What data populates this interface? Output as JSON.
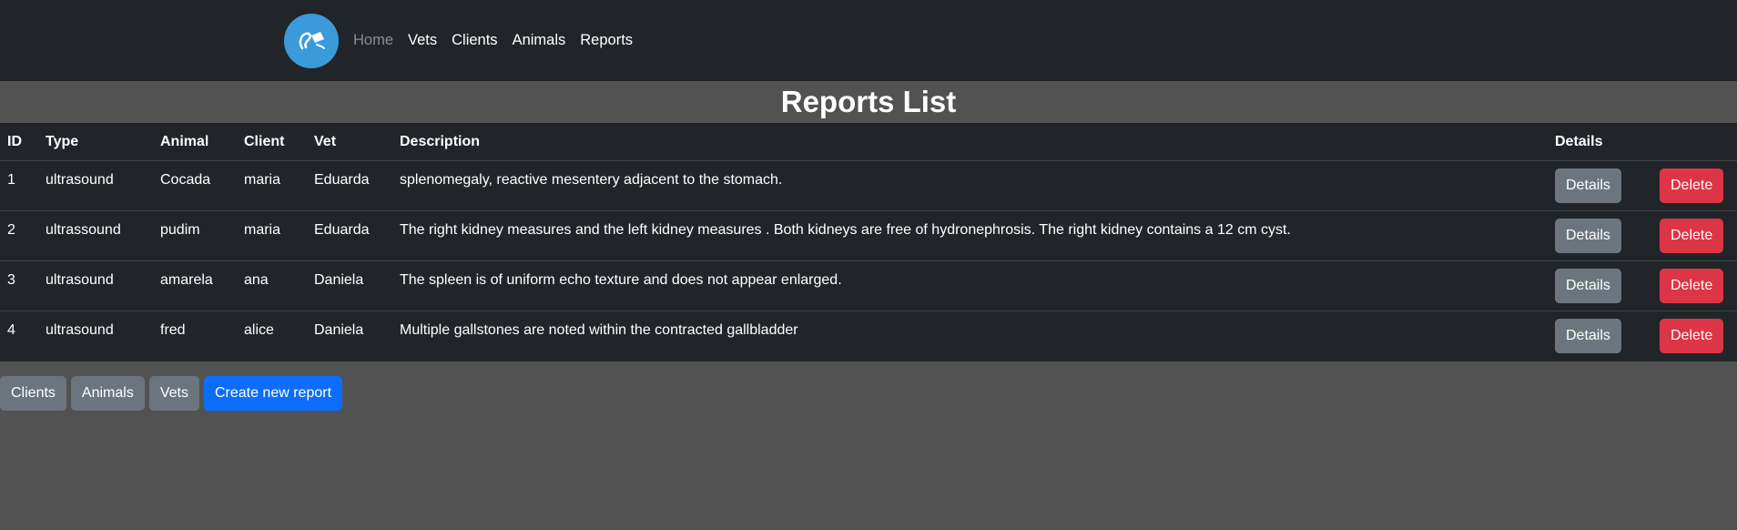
{
  "nav": {
    "links": [
      "Home",
      "Vets",
      "Clients",
      "Animals",
      "Reports"
    ]
  },
  "page": {
    "title": "Reports List"
  },
  "table": {
    "headers": {
      "id": "ID",
      "type": "Type",
      "animal": "Animal",
      "client": "Client",
      "vet": "Vet",
      "description": "Description",
      "details": "Details"
    },
    "rows": [
      {
        "id": "1",
        "type": "ultrasound",
        "animal": "Cocada",
        "client": "maria",
        "vet": "Eduarda",
        "description": "splenomegaly, reactive mesentery adjacent to the stomach.",
        "details_label": "Details",
        "delete_label": "Delete"
      },
      {
        "id": "2",
        "type": "ultrassound",
        "animal": "pudim",
        "client": "maria",
        "vet": "Eduarda",
        "description": "The right kidney measures and the left kidney measures . Both kidneys are free of hydronephrosis. The right kidney contains a 12 cm cyst.",
        "details_label": "Details",
        "delete_label": "Delete"
      },
      {
        "id": "3",
        "type": "ultrasound",
        "animal": "amarela",
        "client": "ana",
        "vet": "Daniela",
        "description": "The spleen is of uniform echo texture and does not appear enlarged.",
        "details_label": "Details",
        "delete_label": "Delete"
      },
      {
        "id": "4",
        "type": "ultrasound",
        "animal": "fred",
        "client": "alice",
        "vet": "Daniela",
        "description": "Multiple gallstones are noted within the contracted gallbladder",
        "details_label": "Details",
        "delete_label": "Delete"
      }
    ]
  },
  "bottom": {
    "clients_label": "Clients",
    "animals_label": "Animals",
    "vets_label": "Vets",
    "create_label": "Create new report"
  },
  "colors": {
    "navbar": "#212529",
    "page_bg": "#525252",
    "secondary": "#6c757d",
    "danger": "#dc3545",
    "primary": "#0d6efd",
    "logo": "#3b9ad9"
  }
}
